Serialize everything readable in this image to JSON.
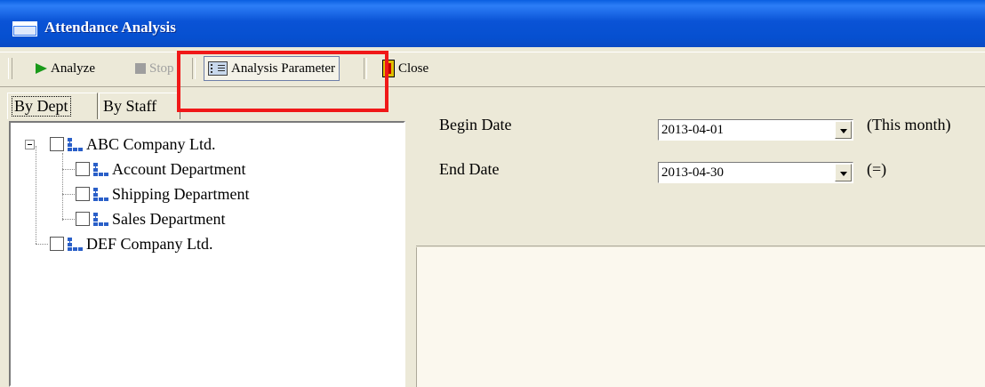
{
  "window": {
    "title": "Attendance Analysis"
  },
  "toolbar": {
    "analyze_label": "Analyze",
    "stop_label": "Stop",
    "analysis_parameter_label": "Analysis Parameter",
    "close_label": "Close"
  },
  "tabs": {
    "by_dept": "By Dept",
    "by_staff": "By Staff"
  },
  "tree": {
    "nodes": [
      {
        "label": "ABC Company Ltd."
      },
      {
        "label": "Account Department"
      },
      {
        "label": "Shipping Department"
      },
      {
        "label": "Sales Department"
      },
      {
        "label": "DEF Company Ltd."
      }
    ]
  },
  "params": {
    "begin_label": "Begin Date",
    "begin_value": "2013-04-01",
    "begin_hint": "(This month)",
    "end_label": "End Date",
    "end_value": "2013-04-30",
    "end_hint": "(=)"
  },
  "colors": {
    "highlight": "#f01818",
    "titlebar": "#0a53d6"
  },
  "icons": [
    "window-icon",
    "play-icon",
    "stop-icon",
    "parameter-icon",
    "close-icon",
    "org-chart-icon",
    "chevron-down-icon"
  ]
}
